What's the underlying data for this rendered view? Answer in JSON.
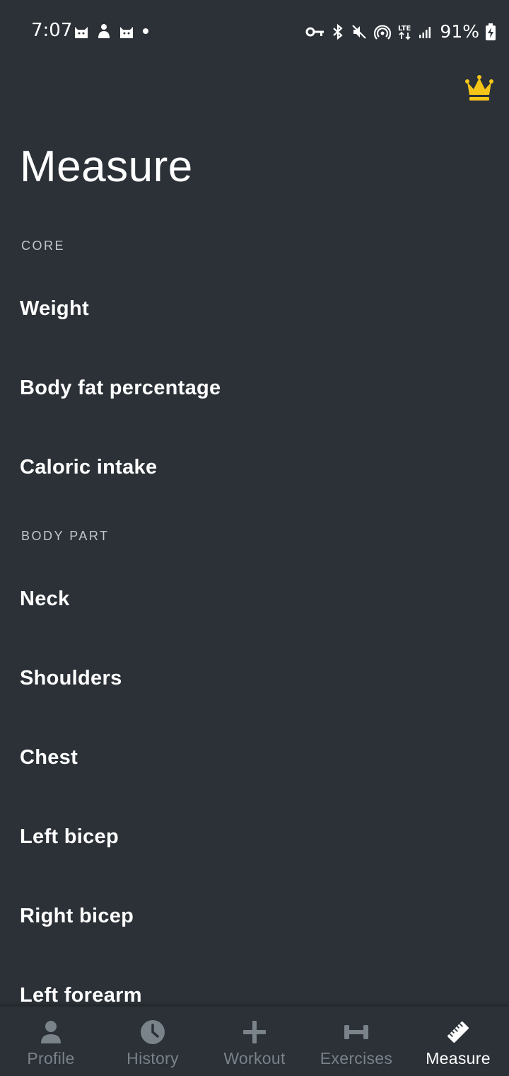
{
  "status_bar": {
    "time": "7:07",
    "battery": "91%"
  },
  "header": {
    "title": "Measure",
    "premium_icon": "crown-icon",
    "premium_color": "#f5c518"
  },
  "sections": [
    {
      "label": "CORE",
      "items": [
        "Weight",
        "Body fat percentage",
        "Caloric intake"
      ]
    },
    {
      "label": "BODY PART",
      "items": [
        "Neck",
        "Shoulders",
        "Chest",
        "Left bicep",
        "Right bicep",
        "Left forearm"
      ]
    }
  ],
  "bottom_nav": {
    "items": [
      {
        "label": "Profile",
        "icon": "person-icon"
      },
      {
        "label": "History",
        "icon": "clock-icon"
      },
      {
        "label": "Workout",
        "icon": "plus-icon"
      },
      {
        "label": "Exercises",
        "icon": "dumbbell-icon"
      },
      {
        "label": "Measure",
        "icon": "ruler-icon"
      }
    ],
    "active": "Measure",
    "active_color": "#ffffff",
    "inactive_color": "#7a828a"
  }
}
